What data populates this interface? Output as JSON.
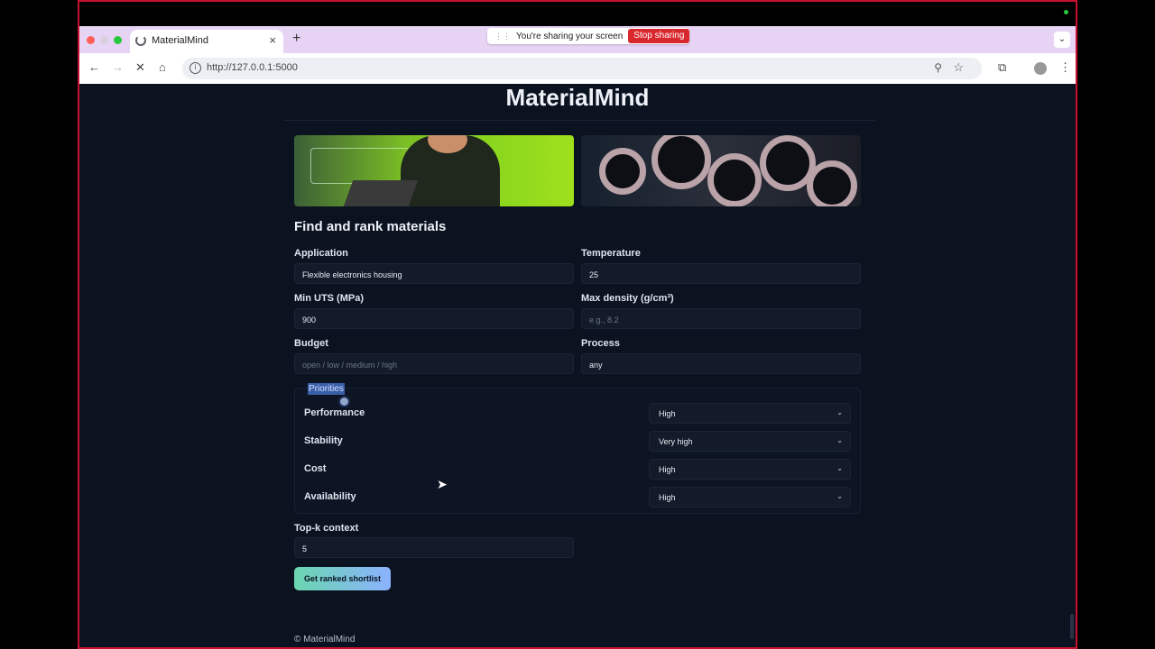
{
  "browser": {
    "tab_title": "MaterialMind",
    "tab_close": "×",
    "new_tab": "+",
    "share_text": "You're sharing your screen",
    "share_stop": "Stop sharing",
    "url": "http://127.0.0.1:5000"
  },
  "page": {
    "brand": "MaterialMind",
    "heading": "Find and rank materials",
    "fields": {
      "application": {
        "label": "Application",
        "value": "Flexible electronics housing"
      },
      "temperature": {
        "label": "Temperature",
        "value": "25"
      },
      "min_uts": {
        "label": "Min UTS (MPa)",
        "value": "900"
      },
      "max_density": {
        "label": "Max density (g/cm³)",
        "placeholder": "e.g., 8.2"
      },
      "budget": {
        "label": "Budget",
        "placeholder": "open / low / medium / high"
      },
      "process": {
        "label": "Process",
        "value": "any"
      },
      "topk": {
        "label": "Top-k context",
        "value": "5"
      }
    },
    "priorities": {
      "legend": "Priorities",
      "rows": [
        {
          "label": "Performance",
          "value": "High"
        },
        {
          "label": "Stability",
          "value": "Very high"
        },
        {
          "label": "Cost",
          "value": "High"
        },
        {
          "label": "Availability",
          "value": "High"
        }
      ]
    },
    "submit_label": "Get ranked shortlist",
    "footer": "© MaterialMind"
  }
}
